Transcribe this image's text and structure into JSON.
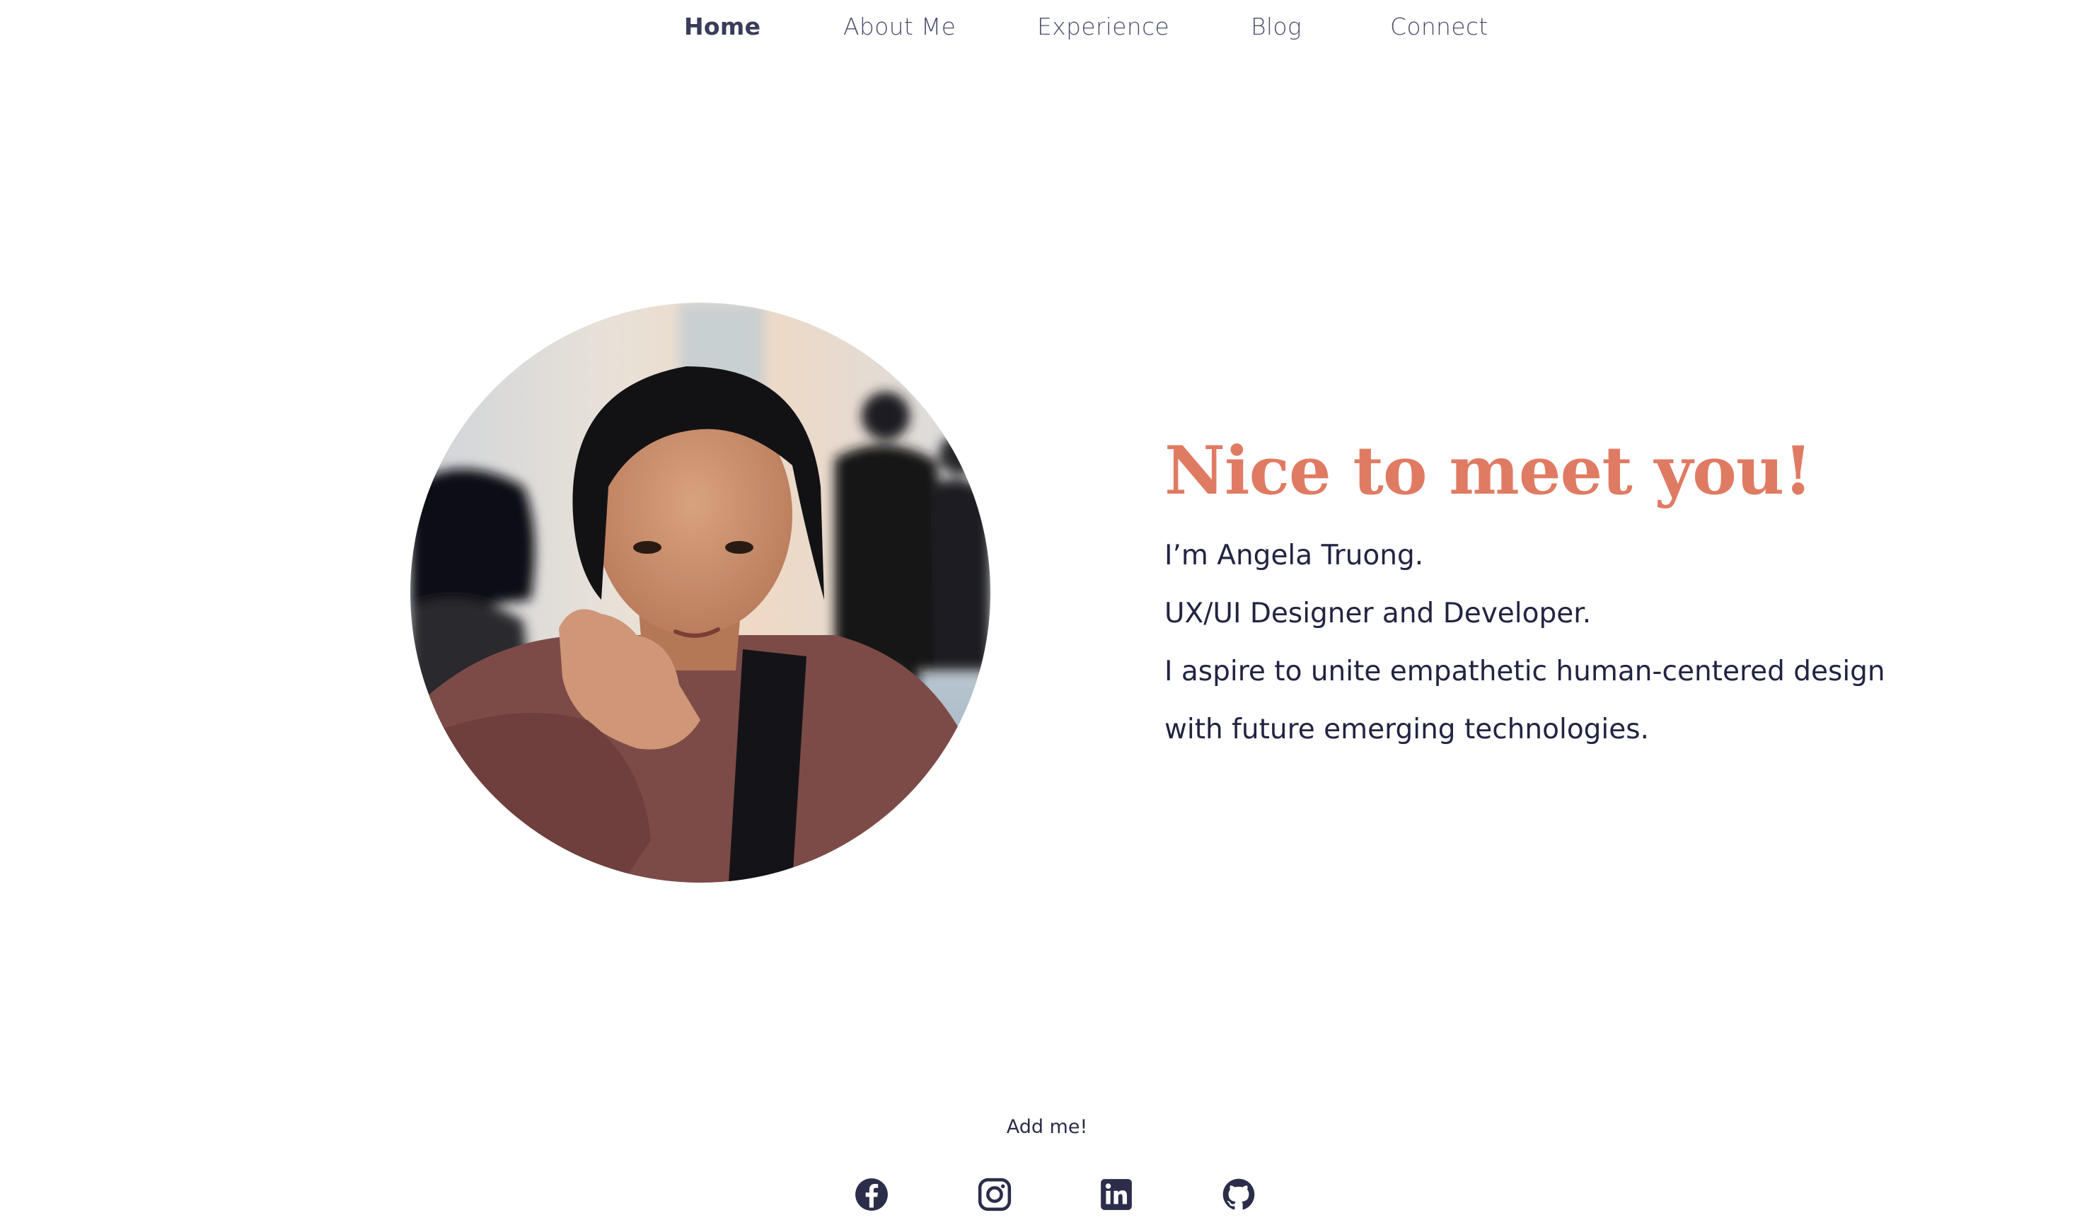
{
  "nav": {
    "items": [
      {
        "label": "Home",
        "active": true
      },
      {
        "label": "About Me",
        "active": false
      },
      {
        "label": "Experience",
        "active": false
      },
      {
        "label": "Blog",
        "active": false
      },
      {
        "label": "Connect",
        "active": false
      }
    ]
  },
  "hero": {
    "heading": "Nice to meet you!",
    "lines": [
      "I’m Angela Truong.",
      "UX/UI Designer and Developer.",
      "I aspire to unite empathetic human-centered design",
      "with future emerging technologies."
    ],
    "portrait_icon": "profile-photo"
  },
  "footer": {
    "add_me": "Add me!",
    "social": [
      {
        "icon": "facebook-icon"
      },
      {
        "icon": "instagram-icon"
      },
      {
        "icon": "linkedin-icon"
      },
      {
        "icon": "github-icon"
      }
    ]
  },
  "colors": {
    "accent": "#e07b63",
    "text": "#222442",
    "nav": "#4c4e6b",
    "background": "#ffffff"
  }
}
